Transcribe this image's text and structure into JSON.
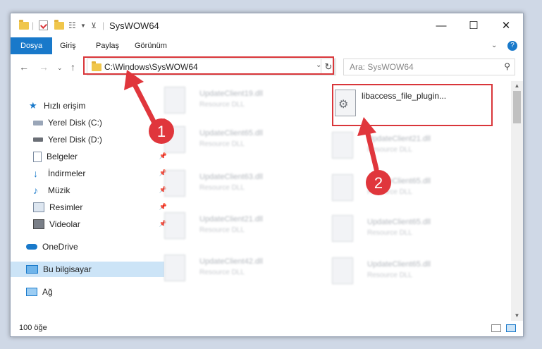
{
  "window": {
    "title": "SysWOW64"
  },
  "ribbon": {
    "tabs": [
      "Dosya",
      "Giriş",
      "Paylaş",
      "Görünüm"
    ]
  },
  "address": {
    "path": "C:\\Windows\\SysWOW64",
    "search_placeholder": "Ara: SysWOW64"
  },
  "sidebar": {
    "items": [
      {
        "label": "Hızlı erişim",
        "icon": "star-icon"
      },
      {
        "label": "Yerel Disk (C:)",
        "icon": "disk-icon",
        "pinned": true
      },
      {
        "label": "Yerel Disk (D:)",
        "icon": "disk-icon",
        "pinned": true
      },
      {
        "label": "Belgeler",
        "icon": "document-icon",
        "pinned": true
      },
      {
        "label": "İndirmeler",
        "icon": "download-icon",
        "pinned": true
      },
      {
        "label": "Müzik",
        "icon": "music-icon",
        "pinned": true
      },
      {
        "label": "Resimler",
        "icon": "pictures-icon",
        "pinned": true
      },
      {
        "label": "Videolar",
        "icon": "video-icon",
        "pinned": true
      },
      {
        "label": "OneDrive",
        "icon": "cloud-icon"
      },
      {
        "label": "Bu bilgisayar",
        "icon": "computer-icon",
        "selected": true
      },
      {
        "label": "Ağ",
        "icon": "network-icon"
      }
    ]
  },
  "files": {
    "left": [
      {
        "name": "UpdateClient19.dll",
        "type": "Resource DLL"
      },
      {
        "name": "UpdateClient65.dll",
        "type": "Resource DLL"
      },
      {
        "name": "UpdateClient63.dll",
        "type": "Resource DLL"
      },
      {
        "name": "UpdateClient21.dll",
        "type": "Resource DLL"
      },
      {
        "name": "UpdateClient42.dll",
        "type": "Resource DLL"
      }
    ],
    "right": [
      {
        "name": "libaccess_file_plugin...",
        "type": ""
      },
      {
        "name": "UpdateClient21.dll",
        "type": "Resource DLL"
      },
      {
        "name": "UpdateClient65.dll",
        "type": "Resource DLL"
      },
      {
        "name": "UpdateClient65.dll",
        "type": "Resource DLL"
      },
      {
        "name": "UpdateClient65.dll",
        "type": "Resource DLL"
      }
    ]
  },
  "status": {
    "count": "100 öğe"
  },
  "annotations": {
    "step1": "1",
    "step2": "2"
  },
  "colors": {
    "accent": "#1979ca",
    "highlight": "#d9363a"
  }
}
